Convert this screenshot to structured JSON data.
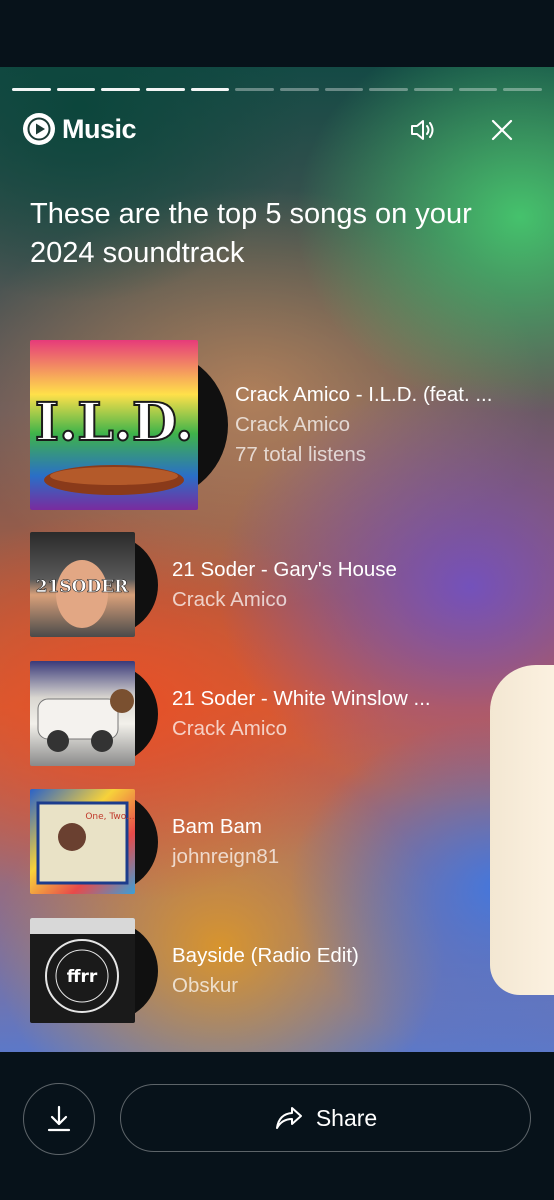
{
  "app": {
    "brand": "Music",
    "accent": "#ff0000"
  },
  "story": {
    "segments_total": 12,
    "segments_completed": 5,
    "headline": "These are the top 5 songs on your 2024 soundtrack"
  },
  "icons": {
    "logo": "youtube-music-logo",
    "sound": "speaker-icon",
    "close": "close-icon",
    "download": "download-icon",
    "share": "share-arrow-icon"
  },
  "tracks": [
    {
      "rank": 1,
      "title": "Crack Amico - I.L.D. (feat. ...",
      "artist": "Crack Amico",
      "listens": "77 total listens",
      "cover_text": "I.L.D."
    },
    {
      "rank": 2,
      "title": "21 Soder - Gary's House",
      "artist": "Crack Amico",
      "cover_text": "21SODER"
    },
    {
      "rank": 3,
      "title": "21 Soder - White Winslow ...",
      "artist": "Crack Amico"
    },
    {
      "rank": 4,
      "title": "Bam Bam",
      "artist": "johnreign81",
      "cover_text": "One, Two..."
    },
    {
      "rank": 5,
      "title": "Bayside (Radio Edit)",
      "artist": "Obskur",
      "cover_text": "ffrr"
    }
  ],
  "actions": {
    "share_label": "Share"
  }
}
